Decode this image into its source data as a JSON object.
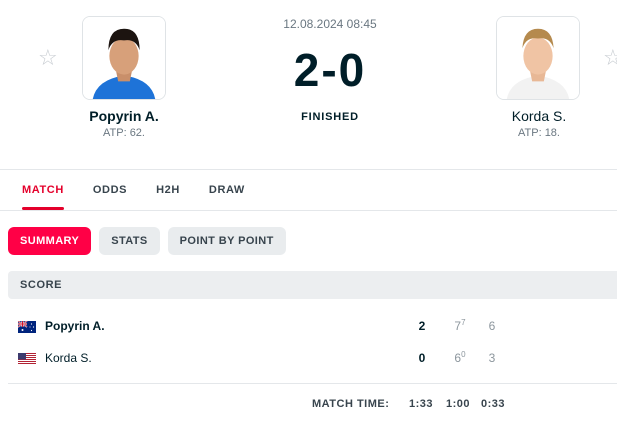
{
  "match": {
    "datetime": "12.08.2024 08:45",
    "score": "2-0",
    "status": "FINISHED"
  },
  "home": {
    "name": "Popyrin A.",
    "rank": "ATP: 62.",
    "flag": "australia-flag-icon"
  },
  "away": {
    "name": "Korda S.",
    "rank": "ATP: 18.",
    "flag": "usa-flag-icon"
  },
  "tabs": [
    "MATCH",
    "ODDS",
    "H2H",
    "DRAW"
  ],
  "subtabs": [
    "SUMMARY",
    "STATS",
    "POINT BY POINT"
  ],
  "score_header": "SCORE",
  "scoreboard": {
    "home": {
      "name": "Popyrin A.",
      "sets": "2",
      "set1": "7",
      "set1_tb": "7",
      "set2": "6"
    },
    "away": {
      "name": "Korda S.",
      "sets": "0",
      "set1": "6",
      "set1_tb": "0",
      "set2": "3"
    }
  },
  "match_time": {
    "label": "MATCH TIME:",
    "total": "1:33",
    "set1": "1:00",
    "set2": "0:33"
  },
  "colors": {
    "accent": "#e4002b",
    "pill_active": "#ff0046"
  }
}
